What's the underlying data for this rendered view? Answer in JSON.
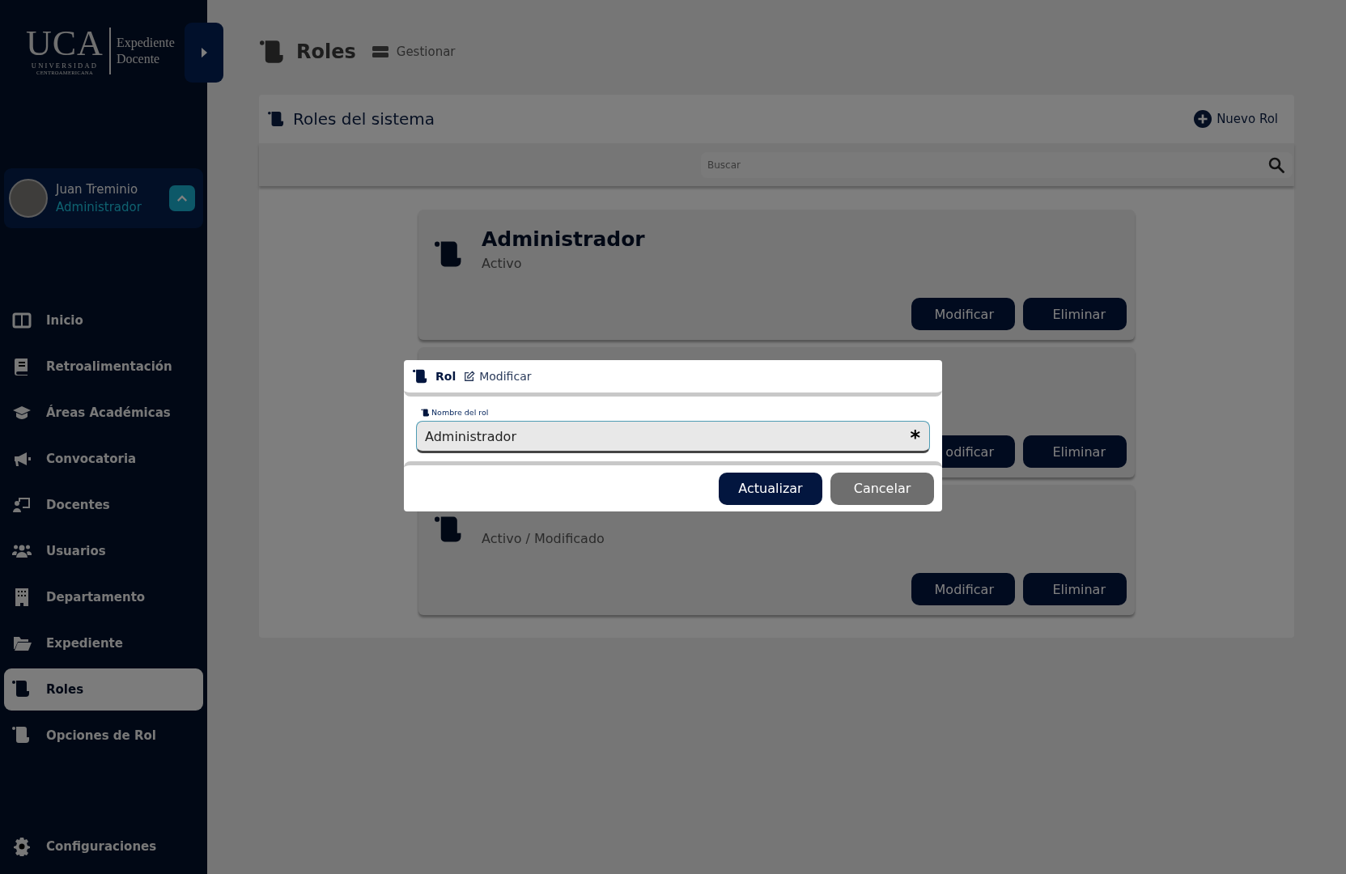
{
  "sidebar": {
    "logo": {
      "mark": "UCA",
      "line_1": "UNIVERSIDAD",
      "line_2": "CENTROAMERICANA",
      "product_1": "Expediente",
      "product_2": "Docente"
    },
    "user": {
      "name": "Juan Treminio",
      "role": "Administrador"
    },
    "menu": [
      {
        "label": "Inicio",
        "selected": false
      },
      {
        "label": "Retroalimentación",
        "selected": false
      },
      {
        "label": "Áreas Académicas",
        "selected": false
      },
      {
        "label": "Convocatoria",
        "selected": false
      },
      {
        "label": "Docentes",
        "selected": false
      },
      {
        "label": "Usuarios",
        "selected": false
      },
      {
        "label": "Departamento",
        "selected": false
      },
      {
        "label": "Expediente",
        "selected": false
      },
      {
        "label": "Roles",
        "selected": true
      },
      {
        "label": "Opciones de Rol",
        "selected": false
      }
    ],
    "settings_item": {
      "label": "Configuraciones"
    }
  },
  "page_header": {
    "title": "Roles",
    "breadcrumb": "Gestionar"
  },
  "panel": {
    "title": "Roles del sistema",
    "action": "Nuevo Rol",
    "search": {
      "placeholder": "Buscar"
    },
    "cards": [
      {
        "title": "Administrador",
        "status": "Activo",
        "buttons": [
          "Modificar",
          "Eliminar"
        ]
      },
      {
        "buttons": [
          "odificar",
          "Eliminar"
        ]
      },
      {
        "status": "Activo / Modificado",
        "buttons": [
          "Modificar",
          "Eliminar"
        ]
      }
    ]
  },
  "modal": {
    "title": "Rol",
    "subtitle": "Modificar",
    "field": {
      "label": "Nombre del rol",
      "value": "Administrador",
      "required_mark": "*"
    },
    "buttons": [
      {
        "label": "Actualizar",
        "kind": "primary"
      },
      {
        "label": "Cancelar",
        "kind": "secondary"
      }
    ]
  }
}
